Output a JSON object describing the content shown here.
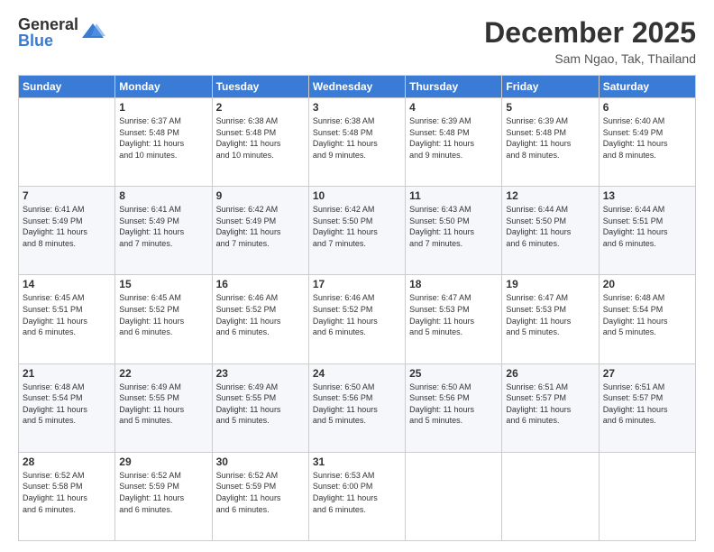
{
  "logo": {
    "general": "General",
    "blue": "Blue"
  },
  "title": "December 2025",
  "location": "Sam Ngao, Tak, Thailand",
  "days_of_week": [
    "Sunday",
    "Monday",
    "Tuesday",
    "Wednesday",
    "Thursday",
    "Friday",
    "Saturday"
  ],
  "weeks": [
    [
      {
        "day": "",
        "info": ""
      },
      {
        "day": "1",
        "info": "Sunrise: 6:37 AM\nSunset: 5:48 PM\nDaylight: 11 hours\nand 10 minutes."
      },
      {
        "day": "2",
        "info": "Sunrise: 6:38 AM\nSunset: 5:48 PM\nDaylight: 11 hours\nand 10 minutes."
      },
      {
        "day": "3",
        "info": "Sunrise: 6:38 AM\nSunset: 5:48 PM\nDaylight: 11 hours\nand 9 minutes."
      },
      {
        "day": "4",
        "info": "Sunrise: 6:39 AM\nSunset: 5:48 PM\nDaylight: 11 hours\nand 9 minutes."
      },
      {
        "day": "5",
        "info": "Sunrise: 6:39 AM\nSunset: 5:48 PM\nDaylight: 11 hours\nand 8 minutes."
      },
      {
        "day": "6",
        "info": "Sunrise: 6:40 AM\nSunset: 5:49 PM\nDaylight: 11 hours\nand 8 minutes."
      }
    ],
    [
      {
        "day": "7",
        "info": "Sunrise: 6:41 AM\nSunset: 5:49 PM\nDaylight: 11 hours\nand 8 minutes."
      },
      {
        "day": "8",
        "info": "Sunrise: 6:41 AM\nSunset: 5:49 PM\nDaylight: 11 hours\nand 7 minutes."
      },
      {
        "day": "9",
        "info": "Sunrise: 6:42 AM\nSunset: 5:49 PM\nDaylight: 11 hours\nand 7 minutes."
      },
      {
        "day": "10",
        "info": "Sunrise: 6:42 AM\nSunset: 5:50 PM\nDaylight: 11 hours\nand 7 minutes."
      },
      {
        "day": "11",
        "info": "Sunrise: 6:43 AM\nSunset: 5:50 PM\nDaylight: 11 hours\nand 7 minutes."
      },
      {
        "day": "12",
        "info": "Sunrise: 6:44 AM\nSunset: 5:50 PM\nDaylight: 11 hours\nand 6 minutes."
      },
      {
        "day": "13",
        "info": "Sunrise: 6:44 AM\nSunset: 5:51 PM\nDaylight: 11 hours\nand 6 minutes."
      }
    ],
    [
      {
        "day": "14",
        "info": "Sunrise: 6:45 AM\nSunset: 5:51 PM\nDaylight: 11 hours\nand 6 minutes."
      },
      {
        "day": "15",
        "info": "Sunrise: 6:45 AM\nSunset: 5:52 PM\nDaylight: 11 hours\nand 6 minutes."
      },
      {
        "day": "16",
        "info": "Sunrise: 6:46 AM\nSunset: 5:52 PM\nDaylight: 11 hours\nand 6 minutes."
      },
      {
        "day": "17",
        "info": "Sunrise: 6:46 AM\nSunset: 5:52 PM\nDaylight: 11 hours\nand 6 minutes."
      },
      {
        "day": "18",
        "info": "Sunrise: 6:47 AM\nSunset: 5:53 PM\nDaylight: 11 hours\nand 5 minutes."
      },
      {
        "day": "19",
        "info": "Sunrise: 6:47 AM\nSunset: 5:53 PM\nDaylight: 11 hours\nand 5 minutes."
      },
      {
        "day": "20",
        "info": "Sunrise: 6:48 AM\nSunset: 5:54 PM\nDaylight: 11 hours\nand 5 minutes."
      }
    ],
    [
      {
        "day": "21",
        "info": "Sunrise: 6:48 AM\nSunset: 5:54 PM\nDaylight: 11 hours\nand 5 minutes."
      },
      {
        "day": "22",
        "info": "Sunrise: 6:49 AM\nSunset: 5:55 PM\nDaylight: 11 hours\nand 5 minutes."
      },
      {
        "day": "23",
        "info": "Sunrise: 6:49 AM\nSunset: 5:55 PM\nDaylight: 11 hours\nand 5 minutes."
      },
      {
        "day": "24",
        "info": "Sunrise: 6:50 AM\nSunset: 5:56 PM\nDaylight: 11 hours\nand 5 minutes."
      },
      {
        "day": "25",
        "info": "Sunrise: 6:50 AM\nSunset: 5:56 PM\nDaylight: 11 hours\nand 5 minutes."
      },
      {
        "day": "26",
        "info": "Sunrise: 6:51 AM\nSunset: 5:57 PM\nDaylight: 11 hours\nand 6 minutes."
      },
      {
        "day": "27",
        "info": "Sunrise: 6:51 AM\nSunset: 5:57 PM\nDaylight: 11 hours\nand 6 minutes."
      }
    ],
    [
      {
        "day": "28",
        "info": "Sunrise: 6:52 AM\nSunset: 5:58 PM\nDaylight: 11 hours\nand 6 minutes."
      },
      {
        "day": "29",
        "info": "Sunrise: 6:52 AM\nSunset: 5:59 PM\nDaylight: 11 hours\nand 6 minutes."
      },
      {
        "day": "30",
        "info": "Sunrise: 6:52 AM\nSunset: 5:59 PM\nDaylight: 11 hours\nand 6 minutes."
      },
      {
        "day": "31",
        "info": "Sunrise: 6:53 AM\nSunset: 6:00 PM\nDaylight: 11 hours\nand 6 minutes."
      },
      {
        "day": "",
        "info": ""
      },
      {
        "day": "",
        "info": ""
      },
      {
        "day": "",
        "info": ""
      }
    ]
  ]
}
